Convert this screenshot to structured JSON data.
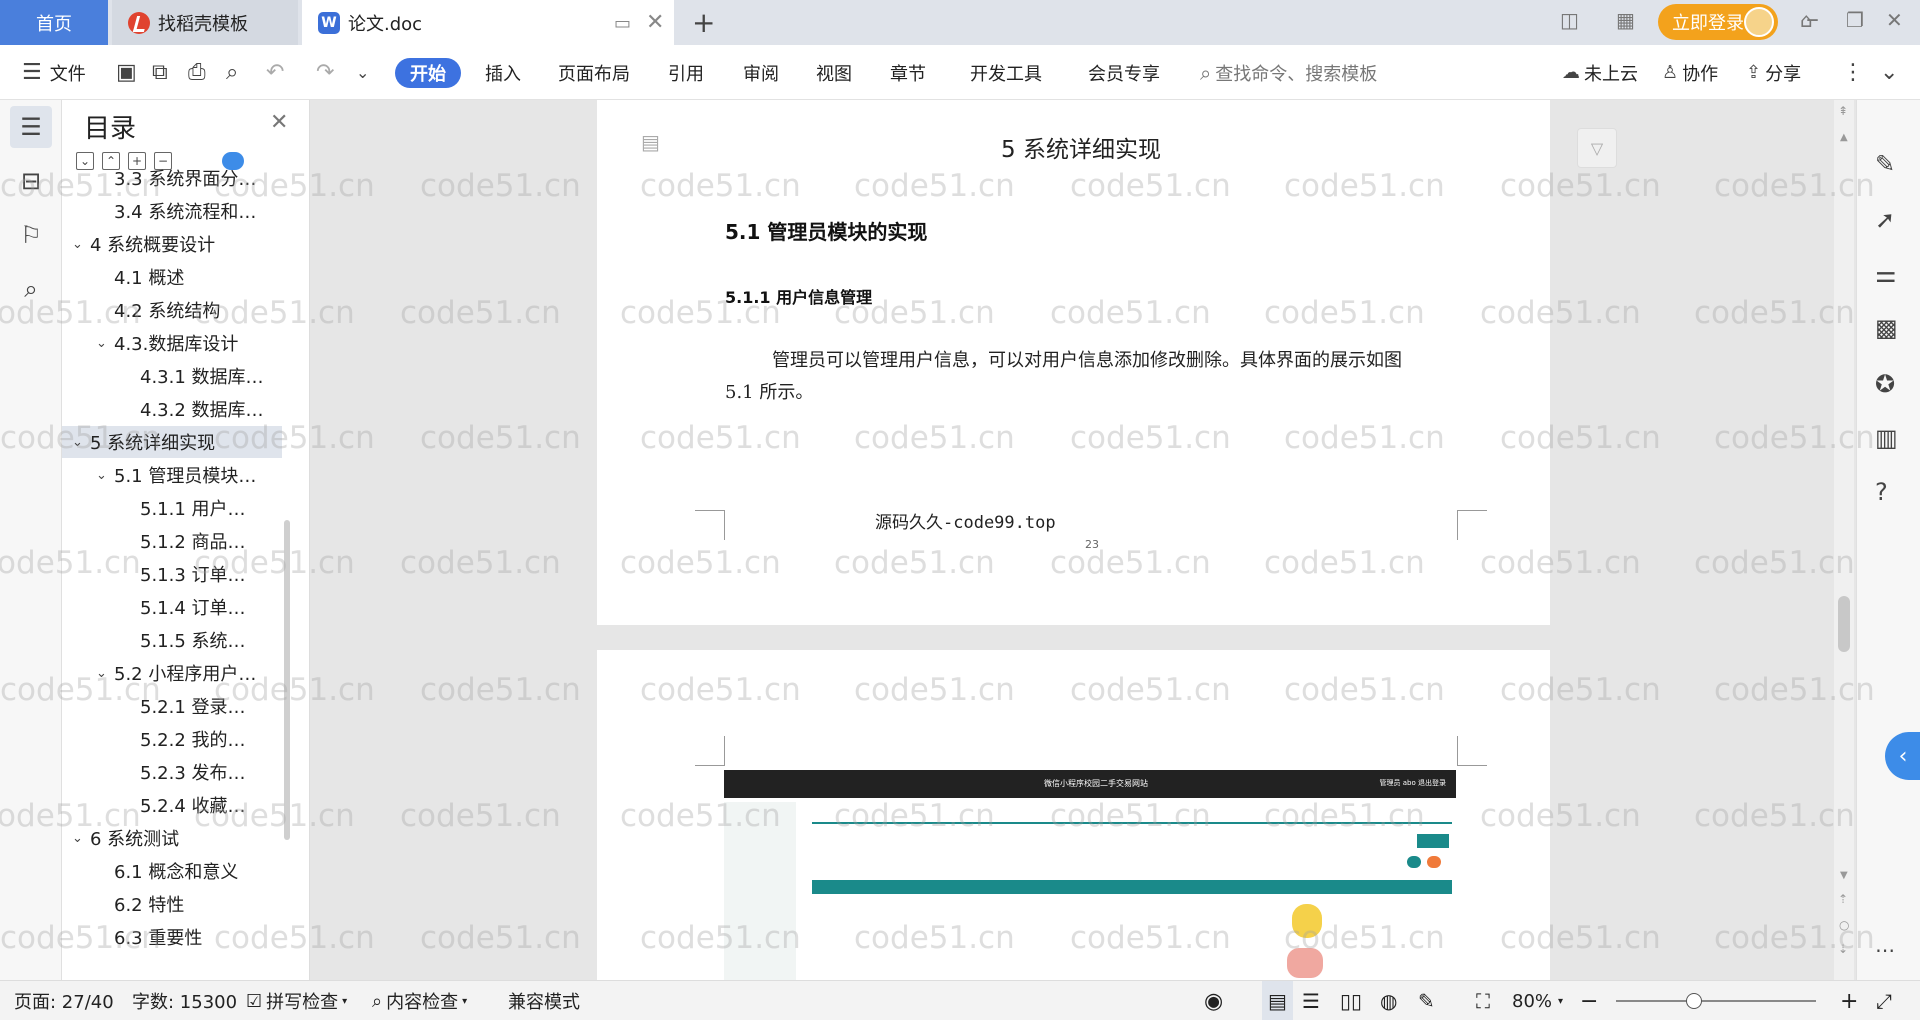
{
  "tabs": {
    "home": "首页",
    "templates": "找稻壳模板",
    "doc": "论文.doc",
    "login": "立即登录"
  },
  "toolbar": {
    "file": "文件",
    "start": "开始",
    "insert": "插入",
    "layout": "页面布局",
    "reference": "引用",
    "review": "审阅",
    "view": "视图",
    "chapter": "章节",
    "devtools": "开发工具",
    "vip": "会员专享",
    "search": "查找命令、搜索模板",
    "cloud": "未上云",
    "collab": "协作",
    "share": "分享"
  },
  "toc": {
    "title": "目录",
    "items": [
      {
        "label": "3.3 系统界面分…",
        "level": 2
      },
      {
        "label": "3.4 系统流程和…",
        "level": 2
      },
      {
        "label": "4 系统概要设计",
        "level": 1
      },
      {
        "label": "4.1 概述",
        "level": 2
      },
      {
        "label": "4.2 系统结构",
        "level": 2
      },
      {
        "label": "4.3.数据库设计",
        "level": 2
      },
      {
        "label": "4.3.1 数据库…",
        "level": 3
      },
      {
        "label": "4.3.2 数据库…",
        "level": 3
      },
      {
        "label": "5 系统详细实现",
        "level": 1
      },
      {
        "label": "5.1  管理员模块…",
        "level": 2
      },
      {
        "label": "5.1.1  用户…",
        "level": 3
      },
      {
        "label": "5.1.2  商品…",
        "level": 3
      },
      {
        "label": "5.1.3  订单…",
        "level": 3
      },
      {
        "label": "5.1.4  订单…",
        "level": 3
      },
      {
        "label": "5.1.5  系统…",
        "level": 3
      },
      {
        "label": "5.2  小程序用户…",
        "level": 2
      },
      {
        "label": "5.2.1  登录…",
        "level": 3
      },
      {
        "label": "5.2.2  我的…",
        "level": 3
      },
      {
        "label": "5.2.3  发布…",
        "level": 3
      },
      {
        "label": "5.2.4  收藏…",
        "level": 3
      },
      {
        "label": "6 系统测试",
        "level": 1
      },
      {
        "label": "6.1 概念和意义",
        "level": 2
      },
      {
        "label": "6.2 特性",
        "level": 2
      },
      {
        "label": "6.3 重要性",
        "level": 2
      }
    ]
  },
  "doc": {
    "chapter": "5 系统详细实现",
    "section": "5.1  管理员模块的实现",
    "subsection": "5.1.1  用户信息管理",
    "para1": "管理员可以管理用户信息，可以对用户信息添加修改删除。具体界面的展示如图",
    "para2": "5.1 所示。",
    "footer": "源码久久-code99.top",
    "pagenum": "23",
    "watermark": "code51.cn"
  },
  "screenshot": {
    "title": "微信小程序校园二手交易网站",
    "user": "管理员 abo    退出登录"
  },
  "status": {
    "page": "页面: 27/40",
    "words": "字数: 15300",
    "spell": "拼写检查",
    "content": "内容检查",
    "compat": "兼容模式",
    "zoom": "80%"
  }
}
